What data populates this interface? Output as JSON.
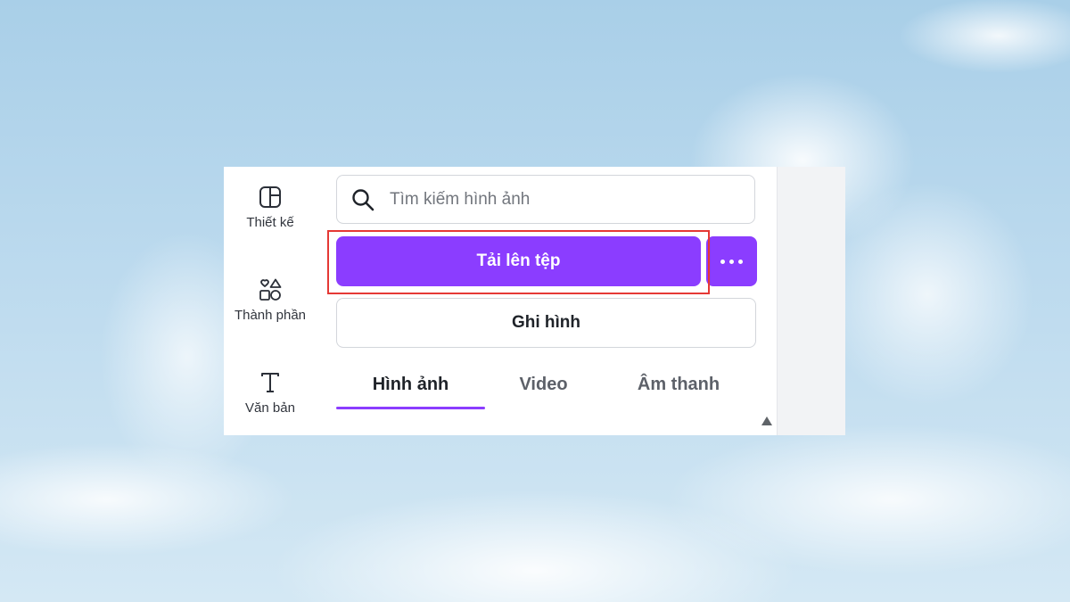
{
  "sidebar": {
    "items": [
      {
        "label": "Thiết kế",
        "icon": "layout-icon"
      },
      {
        "label": "Thành phần",
        "icon": "shapes-icon"
      },
      {
        "label": "Văn bản",
        "icon": "text-icon"
      }
    ]
  },
  "search": {
    "placeholder": "Tìm kiếm hình ảnh",
    "icon": "search-icon"
  },
  "actions": {
    "upload_label": "Tải lên tệp",
    "more_icon": "more-dots-icon",
    "record_label": "Ghi hình"
  },
  "tabs": [
    {
      "label": "Hình ảnh",
      "active": true
    },
    {
      "label": "Video",
      "active": false
    },
    {
      "label": "Âm thanh",
      "active": false
    }
  ],
  "colors": {
    "accent": "#8b3dff",
    "highlight": "#e53935"
  }
}
